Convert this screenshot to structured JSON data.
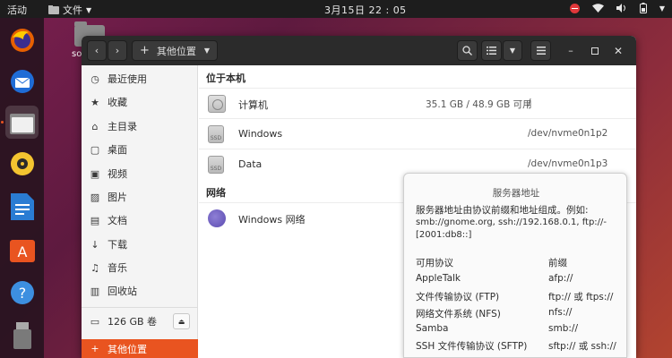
{
  "topbar": {
    "activities": "活动",
    "app_menu": "文件",
    "clock": "3月15日 22 : 05"
  },
  "desktop": {
    "icon_label": "so"
  },
  "dock": {
    "items": [
      "firefox-icon",
      "thunderbird-icon",
      "files-icon",
      "rhythmbox-icon",
      "writer-icon",
      "software-icon",
      "help-icon",
      "usb-drive-icon"
    ]
  },
  "headerbar": {
    "location_label": "其他位置",
    "new_symbol": "+"
  },
  "sidebar": {
    "items": [
      {
        "label": "最近使用",
        "icon": "clock-icon"
      },
      {
        "label": "收藏",
        "icon": "star-icon"
      },
      {
        "label": "主目录",
        "icon": "home-icon"
      },
      {
        "label": "桌面",
        "icon": "desktop-icon"
      },
      {
        "label": "视频",
        "icon": "video-icon"
      },
      {
        "label": "图片",
        "icon": "picture-icon"
      },
      {
        "label": "文档",
        "icon": "document-icon"
      },
      {
        "label": "下载",
        "icon": "download-icon"
      },
      {
        "label": "音乐",
        "icon": "music-icon"
      },
      {
        "label": "回收站",
        "icon": "trash-icon"
      }
    ],
    "volume": "126 GB 卷",
    "other_locations": "其他位置"
  },
  "main": {
    "section_local": "位于本机",
    "section_network": "网络",
    "local_rows": [
      {
        "name": "计算机",
        "size": "35.1 GB / 48.9 GB 可用",
        "path": "/"
      },
      {
        "name": "Windows",
        "size": "",
        "path": "/dev/nvme0n1p2"
      },
      {
        "name": "Data",
        "size": "",
        "path": "/dev/nvme0n1p3"
      }
    ],
    "network_rows": [
      {
        "name": "Windows 网络"
      }
    ]
  },
  "popover": {
    "title": "服务器地址",
    "desc_line1": "服务器地址由协议前缀和地址组成。例如:",
    "desc_line2": "smb://gnome.org, ssh://192.168.0.1, ftp://-",
    "desc_line3": "[2001:db8::]",
    "col_protocol": "可用协议",
    "col_prefix": "前缀",
    "protocols": [
      {
        "name": "AppleTalk",
        "prefix": "afp://"
      },
      {
        "name": "文件传输协议 (FTP)",
        "prefix": "ftp:// 或 ftps://"
      },
      {
        "name": "网络文件系统 (NFS)",
        "prefix": "nfs://"
      },
      {
        "name": "Samba",
        "prefix": "smb://"
      },
      {
        "name": "SSH 文件传输协议 (SFTP)",
        "prefix": "sftp:// 或 ssh://"
      }
    ]
  }
}
